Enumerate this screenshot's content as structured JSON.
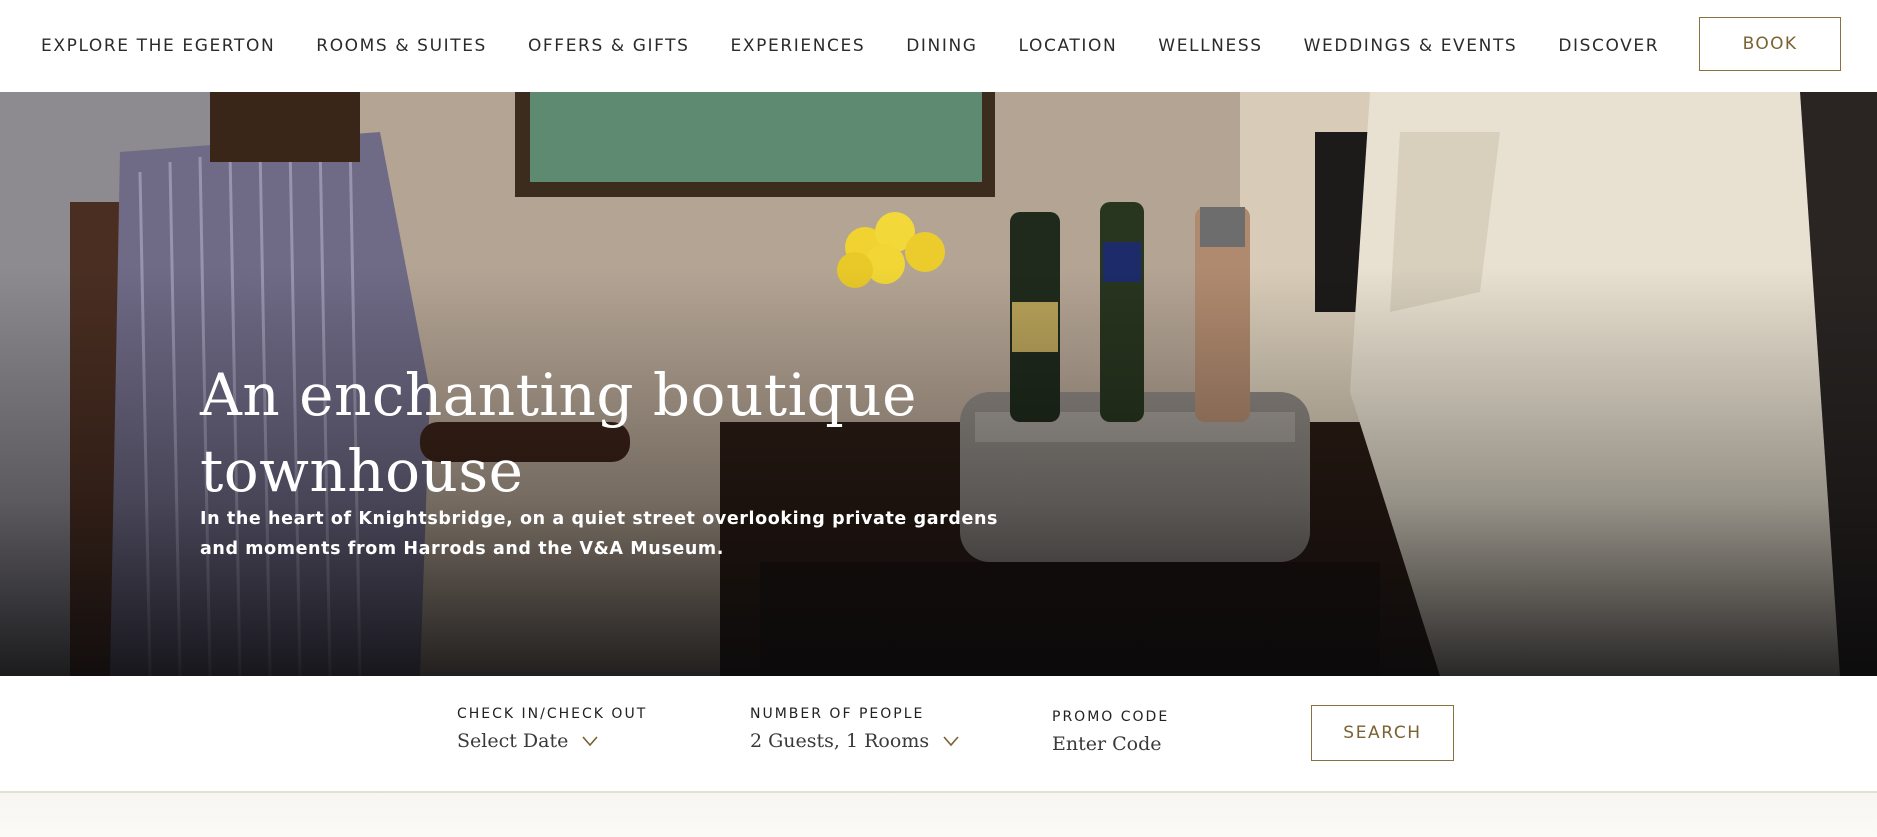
{
  "nav": {
    "items": [
      {
        "label": "EXPLORE THE EGERTON"
      },
      {
        "label": "ROOMS & SUITES"
      },
      {
        "label": "OFFERS & GIFTS"
      },
      {
        "label": "EXPERIENCES"
      },
      {
        "label": "DINING"
      },
      {
        "label": "LOCATION"
      },
      {
        "label": "WELLNESS"
      },
      {
        "label": "WEDDINGS & EVENTS"
      },
      {
        "label": "DISCOVER"
      }
    ],
    "book_label": "BOOK"
  },
  "hero": {
    "title": "An enchanting boutique townhouse",
    "subtitle": "In the heart of Knightsbridge, on a quiet street overlooking private gardens and moments from Harrods and the V&A Museum."
  },
  "booking": {
    "checkin": {
      "label": "CHECK IN/CHECK OUT",
      "value": "Select Date",
      "icon": "chevron-down-icon"
    },
    "people": {
      "label": "NUMBER OF PEOPLE",
      "value": "2 Guests, 1 Rooms",
      "icon": "chevron-down-icon"
    },
    "promo": {
      "label": "PROMO CODE",
      "placeholder": "Enter Code"
    },
    "search_label": "SEARCH"
  },
  "colors": {
    "accent": "#8a7240",
    "accent_text": "#7a6232",
    "divider": "#e3e0cf"
  }
}
